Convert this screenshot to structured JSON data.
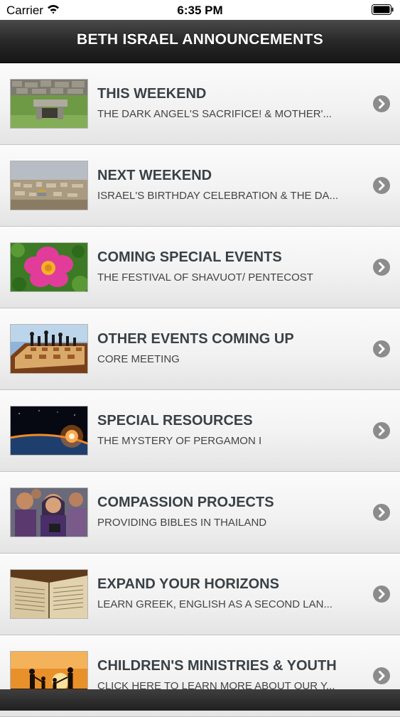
{
  "status_bar": {
    "carrier": "Carrier",
    "time": "6:35 PM"
  },
  "nav": {
    "title": "BETH ISRAEL ANNOUNCEMENTS"
  },
  "items": [
    {
      "title": "THIS WEEKEND",
      "subtitle": "THE DARK ANGEL'S SACRIFICE! & MOTHER'...",
      "thumbnail": "stone-wall-landscape"
    },
    {
      "title": "NEXT WEEKEND",
      "subtitle": "ISRAEL'S BIRTHDAY CELEBRATION & THE DA...",
      "thumbnail": "jerusalem-skyline"
    },
    {
      "title": "COMING SPECIAL EVENTS",
      "subtitle": "THE FESTIVAL OF SHAVUOT/ PENTECOST",
      "thumbnail": "pink-flower"
    },
    {
      "title": "OTHER EVENTS COMING UP",
      "subtitle": "CORE MEETING",
      "thumbnail": "chess-board"
    },
    {
      "title": "SPECIAL RESOURCES",
      "subtitle": "THE MYSTERY OF PERGAMON I",
      "thumbnail": "planet-sunrise"
    },
    {
      "title": "COMPASSION PROJECTS",
      "subtitle": "PROVIDING BIBLES IN THAILAND",
      "thumbnail": "people-with-bibles"
    },
    {
      "title": "EXPAND YOUR HORIZONS",
      "subtitle": "LEARN GREEK, ENGLISH AS A SECOND LAN...",
      "thumbnail": "open-book"
    },
    {
      "title": "CHILDREN'S MINISTRIES & YOUTH",
      "subtitle": "CLICK HERE TO LEARN MORE ABOUT OUR Y...",
      "thumbnail": "family-sunset"
    }
  ]
}
